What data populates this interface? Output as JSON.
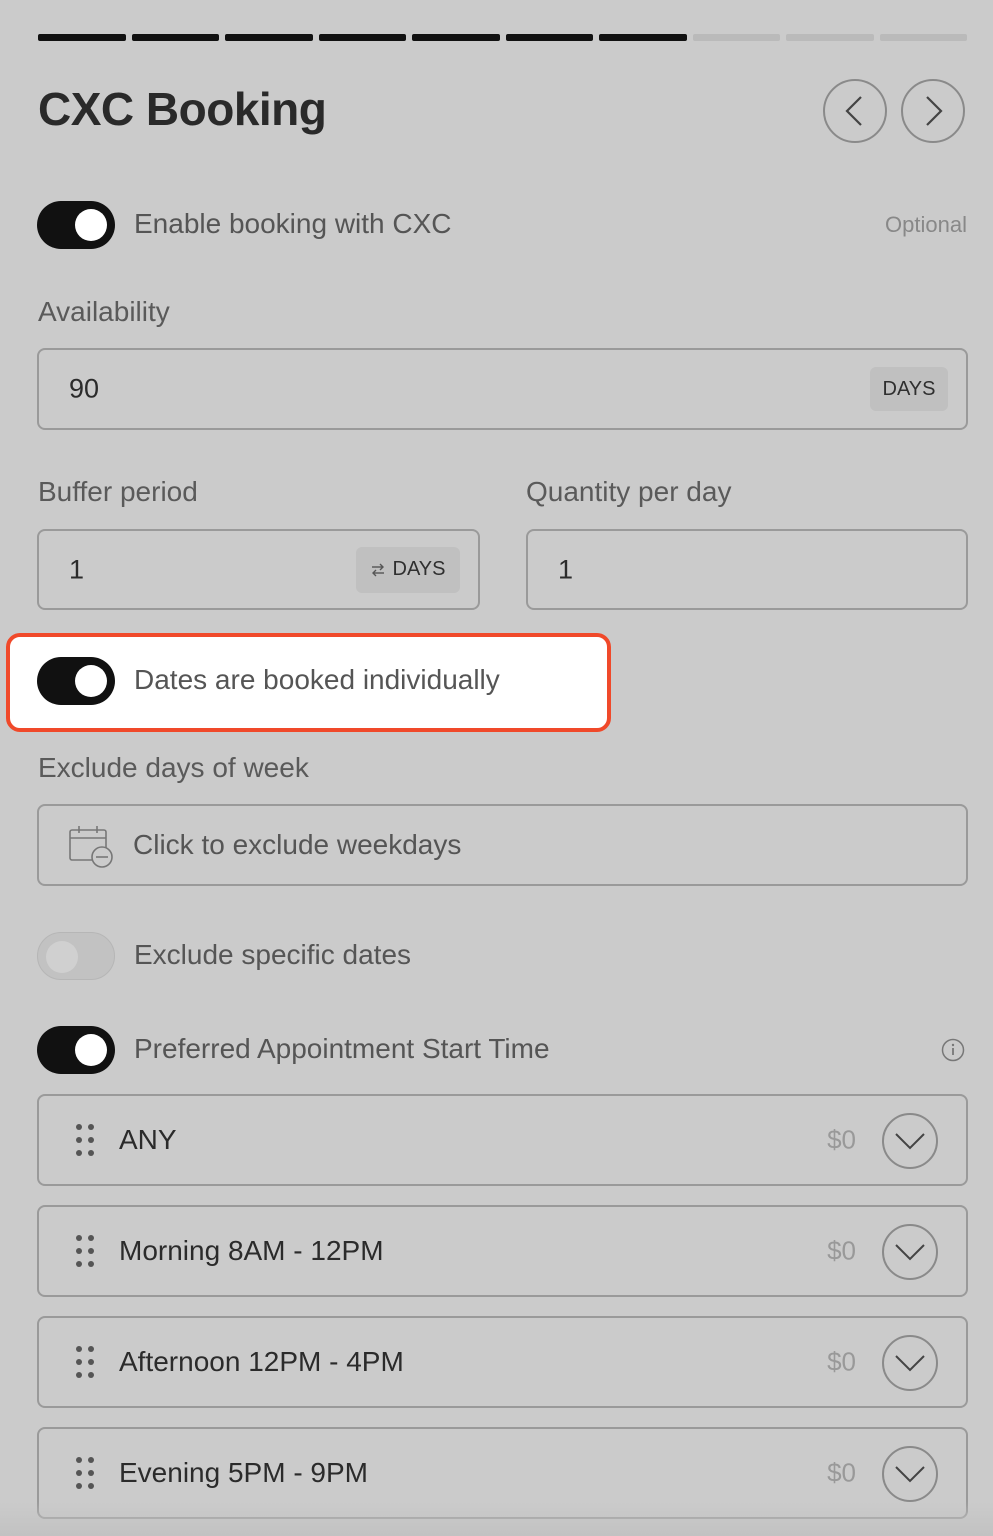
{
  "progress": {
    "total_steps": 10,
    "completed_steps": 7
  },
  "header": {
    "title": "CXC Booking"
  },
  "enable_booking": {
    "label": "Enable booking with CXC",
    "enabled": true,
    "optional_label": "Optional"
  },
  "availability": {
    "label": "Availability",
    "value": "90",
    "unit": "DAYS"
  },
  "buffer_period": {
    "label": "Buffer period",
    "value": "1",
    "unit": "DAYS"
  },
  "quantity_per_day": {
    "label": "Quantity per day",
    "value": "1"
  },
  "dates_individually": {
    "label": "Dates are booked individually",
    "enabled": true
  },
  "exclude_days": {
    "label": "Exclude days of week",
    "placeholder": "Click to exclude weekdays"
  },
  "exclude_dates": {
    "label": "Exclude specific dates",
    "enabled": false
  },
  "preferred_time": {
    "label": "Preferred Appointment Start Time",
    "enabled": true,
    "slots": [
      {
        "label": "ANY",
        "price": "$0"
      },
      {
        "label": "Morning 8AM - 12PM",
        "price": "$0"
      },
      {
        "label": "Afternoon 12PM - 4PM",
        "price": "$0"
      },
      {
        "label": "Evening 5PM - 9PM",
        "price": "$0"
      }
    ]
  },
  "colors": {
    "accent_highlight": "#f0492a",
    "toggle_on": "#111111",
    "background": "#cbcbcb"
  }
}
